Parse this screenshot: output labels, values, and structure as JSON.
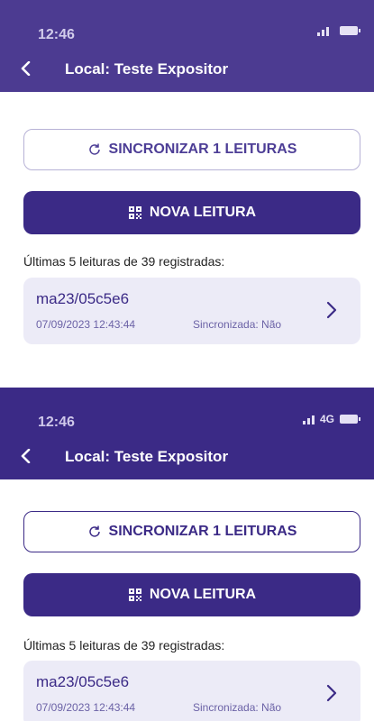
{
  "screens": [
    {
      "status": {
        "time": "12:46",
        "network": ""
      },
      "header": {
        "title": "Local: Teste Expositor"
      },
      "sync_button": {
        "label": "SINCRONIZAR 1 LEITURAS"
      },
      "new_button": {
        "label": "NOVA LEITURA"
      },
      "list": {
        "subtitle": "Últimas 5 leituras de 39 registradas:",
        "items": [
          {
            "code": "ma23/05c5e6",
            "date": "07/09/2023 12:43:44",
            "status": "Sincronizada: Não"
          }
        ]
      }
    },
    {
      "status": {
        "time": "12:46",
        "network": "4G"
      },
      "header": {
        "title": "Local: Teste Expositor"
      },
      "sync_button": {
        "label": "SINCRONIZAR 1 LEITURAS"
      },
      "new_button": {
        "label": "NOVA LEITURA"
      },
      "list": {
        "subtitle": "Últimas 5 leituras de 39 registradas:",
        "items": [
          {
            "code": "ma23/05c5e6",
            "date": "07/09/2023 12:43:44",
            "status": "Sincronizada: Não"
          }
        ]
      }
    }
  ],
  "colors": {
    "primary": "#3b2a86",
    "card_bg": "#ecebf7",
    "muted_text": "#6b62a6"
  }
}
